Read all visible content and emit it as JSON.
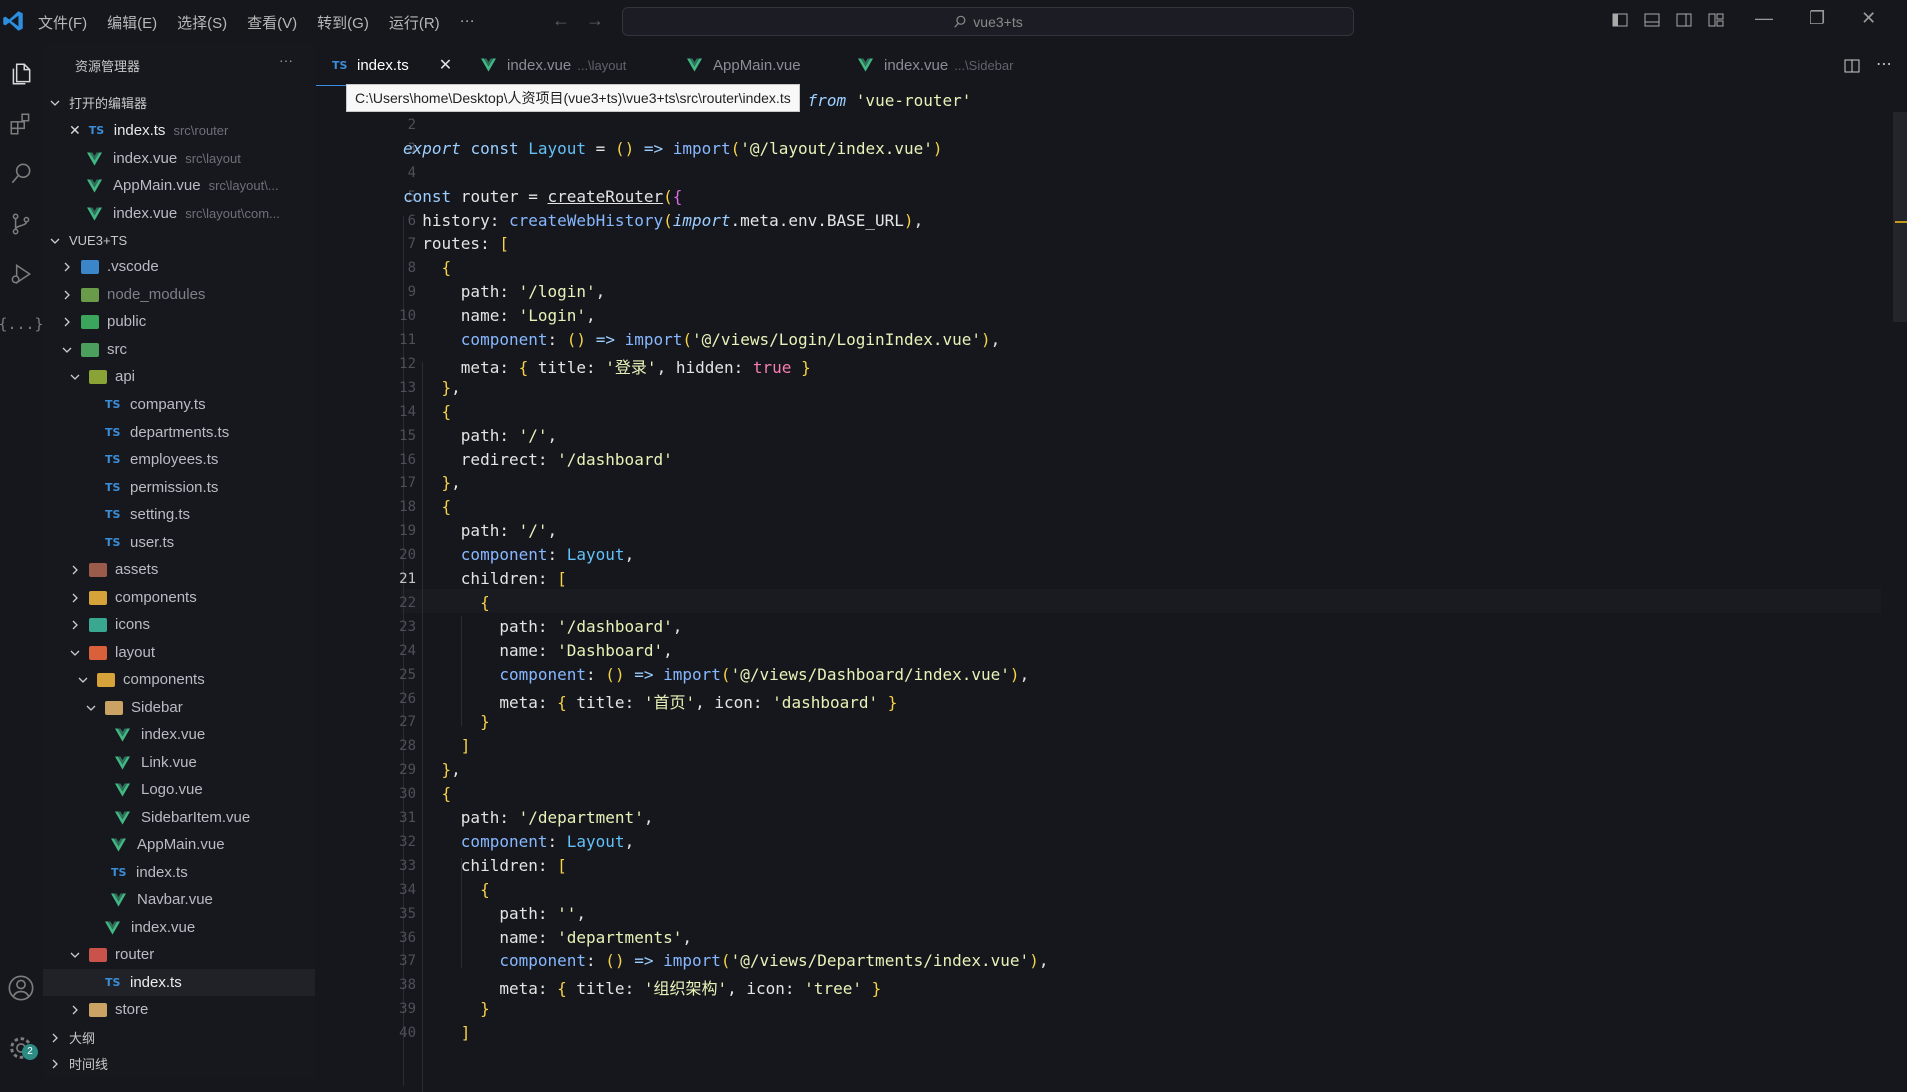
{
  "titlebar": {
    "menu": [
      "文件(F)",
      "编辑(E)",
      "选择(S)",
      "查看(V)",
      "转到(G)",
      "运行(R)",
      "···"
    ],
    "search_text": "vue3+ts"
  },
  "sidebar": {
    "title": "资源管理器",
    "more": "···",
    "open_editors_label": "打开的编辑器",
    "open_editors": [
      {
        "name": "index.ts",
        "path": "src\\router"
      },
      {
        "name": "index.vue",
        "path": "src\\layout"
      },
      {
        "name": "AppMain.vue",
        "path": "src\\layout\\..."
      },
      {
        "name": "index.vue",
        "path": "src\\layout\\com..."
      }
    ],
    "project_label": "VUE3+TS",
    "tree": [
      ".vscode",
      "node_modules",
      "public",
      "src",
      "api",
      "company.ts",
      "departments.ts",
      "employees.ts",
      "permission.ts",
      "setting.ts",
      "user.ts",
      "assets",
      "components",
      "icons",
      "layout",
      "components",
      "Sidebar",
      "index.vue",
      "Link.vue",
      "Logo.vue",
      "SidebarItem.vue",
      "AppMain.vue",
      "index.ts",
      "Navbar.vue",
      "index.vue",
      "router",
      "index.ts",
      "store"
    ],
    "outline_label": "大纲",
    "timeline_label": "时间线"
  },
  "activity": {
    "badge_count": "2"
  },
  "tabs": [
    {
      "name": "index.ts",
      "hint": ""
    },
    {
      "name": "index.vue",
      "hint": "...\\layout"
    },
    {
      "name": "AppMain.vue",
      "hint": ""
    },
    {
      "name": "index.vue",
      "hint": "...\\Sidebar"
    }
  ],
  "tooltip": "C:\\Users\\home\\Desktop\\人资项目(vue3+ts)\\vue3+ts\\src\\router\\index.ts",
  "editor": {
    "line_numbers": [
      "1",
      "2",
      "3",
      "4",
      "5",
      "6",
      "7",
      "8",
      "9",
      "10",
      "11",
      "12",
      "13",
      "14",
      "15",
      "16",
      "17",
      "18",
      "19",
      "20",
      "21",
      "22",
      "23",
      "24",
      "25",
      "26",
      "27",
      "28",
      "29",
      "30",
      "31",
      "32",
      "33",
      "34",
      "35",
      "36",
      "37",
      "38",
      "39",
      "40"
    ],
    "current_line": "21",
    "code": [
      "import { createRouter, createWebHistory } from 'vue-router'",
      "",
      "export const Layout = () => import('@/layout/index.vue')",
      "",
      "const router = createRouter({",
      "  history: createWebHistory(import.meta.env.BASE_URL),",
      "  routes: [",
      "    {",
      "      path: '/login',",
      "      name: 'Login',",
      "      component: () => import('@/views/Login/LoginIndex.vue'),",
      "      meta: { title: '登录', hidden: true }",
      "    },",
      "    {",
      "      path: '/',",
      "      redirect: '/dashboard'",
      "    },",
      "    {",
      "      path: '/',",
      "      component: Layout,",
      "      children: [",
      "        {",
      "          path: '/dashboard',",
      "          name: 'Dashboard',",
      "          component: () => import('@/views/Dashboard/index.vue'),",
      "          meta: { title: '首页', icon: 'dashboard' }",
      "        }",
      "      ]",
      "    },",
      "    {",
      "      path: '/department',",
      "      component: Layout,",
      "      children: [",
      "        {",
      "          path: '',",
      "          name: 'departments',",
      "          component: () => import('@/views/Departments/index.vue'),",
      "          meta: { title: '组织架构', icon: 'tree' }",
      "        }",
      "      ]"
    ]
  },
  "colors": {
    "accent": "#3a8ee6",
    "vue_green": "#41b883",
    "ts_blue": "#3c8dd8"
  }
}
